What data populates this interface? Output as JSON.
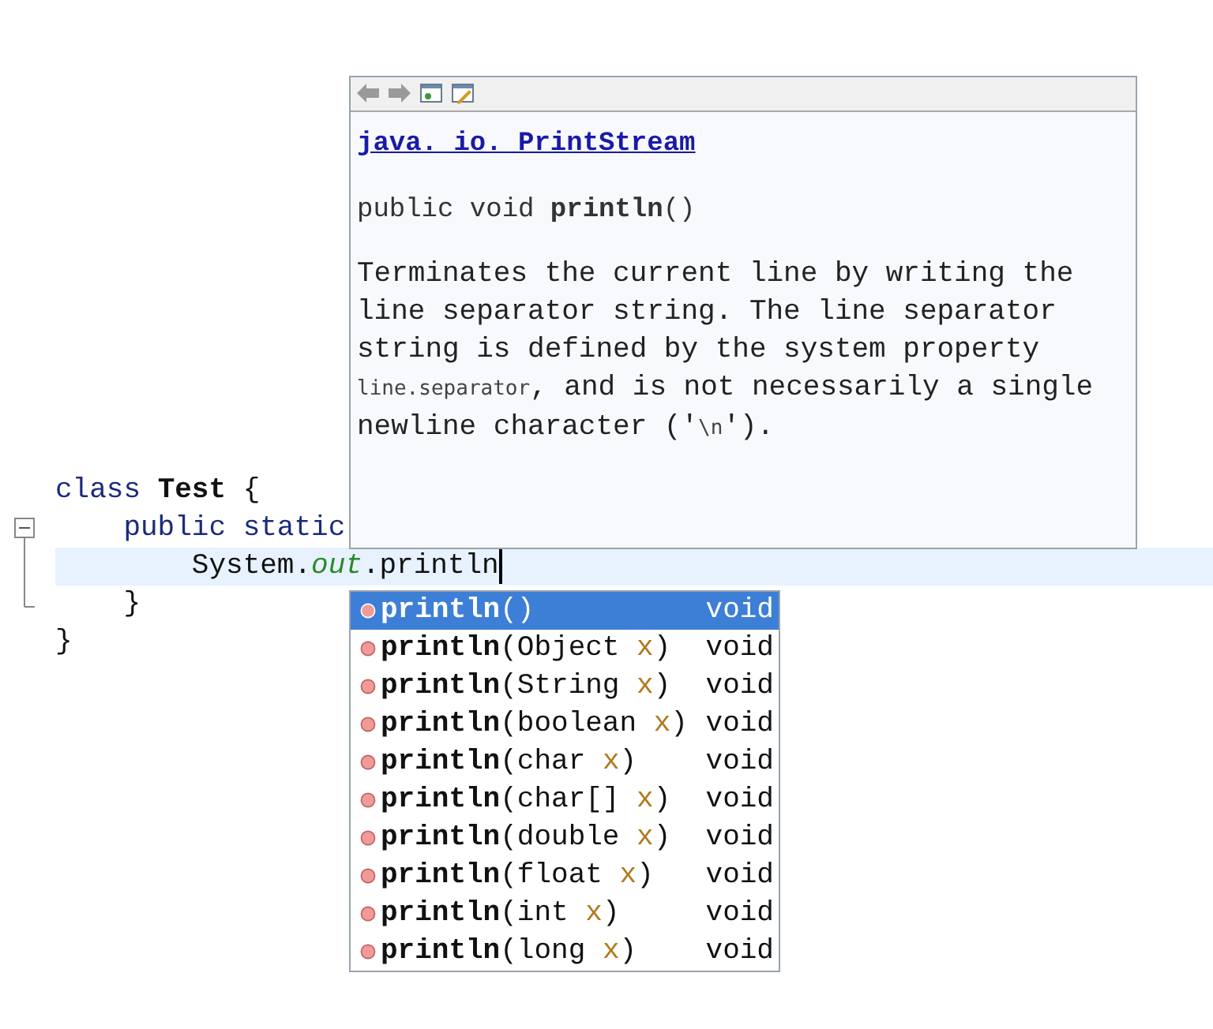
{
  "editor": {
    "lines": [
      {
        "segments": [
          {
            "text": "class",
            "kind": "keyword"
          },
          {
            "text": " Test",
            "kind": "bold"
          },
          {
            "text": " {"
          }
        ],
        "current": false
      },
      {
        "segments": [
          {
            "text": "    public static",
            "kind": "keyword"
          }
        ],
        "current": false
      },
      {
        "segments": [
          {
            "text": "        System."
          },
          {
            "text": "out",
            "kind": "field"
          },
          {
            "text": ".println"
          }
        ],
        "current": true
      },
      {
        "segments": [
          {
            "text": "    }"
          }
        ],
        "current": false
      },
      {
        "segments": [
          {
            "text": "}"
          }
        ],
        "current": false
      }
    ]
  },
  "doc_popup": {
    "toolbar": [
      {
        "kind": "back"
      },
      {
        "kind": "forward"
      },
      {
        "kind": "window"
      },
      {
        "kind": "edit"
      }
    ],
    "link": "java. io. PrintStream",
    "signature": "public void **println**()",
    "description": [
      {
        "text": "Terminates the current line by writing the line separator string. The line separator string is defined by the system property "
      },
      {
        "text": "line.separator",
        "kind": "code"
      },
      {
        "text": ", and is not necessarily a single newline character ('"
      },
      {
        "text": "\\n",
        "kind": "code"
      },
      {
        "text": "')."
      }
    ]
  },
  "completion": {
    "items": [
      {
        "label": [
          {
            "text": "println",
            "kind": "name"
          },
          {
            "text": "()"
          }
        ],
        "type": "void",
        "selected": true
      },
      {
        "label": [
          {
            "text": "println",
            "kind": "name"
          },
          {
            "text": "(Object "
          },
          {
            "text": "x",
            "kind": "param"
          },
          {
            "text": ")"
          }
        ],
        "type": "void",
        "selected": false
      },
      {
        "label": [
          {
            "text": "println",
            "kind": "name"
          },
          {
            "text": "(String "
          },
          {
            "text": "x",
            "kind": "param"
          },
          {
            "text": ")"
          }
        ],
        "type": "void",
        "selected": false
      },
      {
        "label": [
          {
            "text": "println",
            "kind": "name"
          },
          {
            "text": "(boolean "
          },
          {
            "text": "x",
            "kind": "param"
          },
          {
            "text": ")"
          }
        ],
        "type": "void",
        "selected": false
      },
      {
        "label": [
          {
            "text": "println",
            "kind": "name"
          },
          {
            "text": "(char "
          },
          {
            "text": "x",
            "kind": "param"
          },
          {
            "text": ")"
          }
        ],
        "type": "void",
        "selected": false
      },
      {
        "label": [
          {
            "text": "println",
            "kind": "name"
          },
          {
            "text": "(char[] "
          },
          {
            "text": "x",
            "kind": "param"
          },
          {
            "text": ")"
          }
        ],
        "type": "void",
        "selected": false
      },
      {
        "label": [
          {
            "text": "println",
            "kind": "name"
          },
          {
            "text": "(double "
          },
          {
            "text": "x",
            "kind": "param"
          },
          {
            "text": ")"
          }
        ],
        "type": "void",
        "selected": false
      },
      {
        "label": [
          {
            "text": "println",
            "kind": "name"
          },
          {
            "text": "(float "
          },
          {
            "text": "x",
            "kind": "param"
          },
          {
            "text": ")"
          }
        ],
        "type": "void",
        "selected": false
      },
      {
        "label": [
          {
            "text": "println",
            "kind": "name"
          },
          {
            "text": "(int "
          },
          {
            "text": "x",
            "kind": "param"
          },
          {
            "text": ")"
          }
        ],
        "type": "void",
        "selected": false
      },
      {
        "label": [
          {
            "text": "println",
            "kind": "name"
          },
          {
            "text": "(long "
          },
          {
            "text": "x",
            "kind": "param"
          },
          {
            "text": ")"
          }
        ],
        "type": "void",
        "selected": false
      }
    ]
  }
}
